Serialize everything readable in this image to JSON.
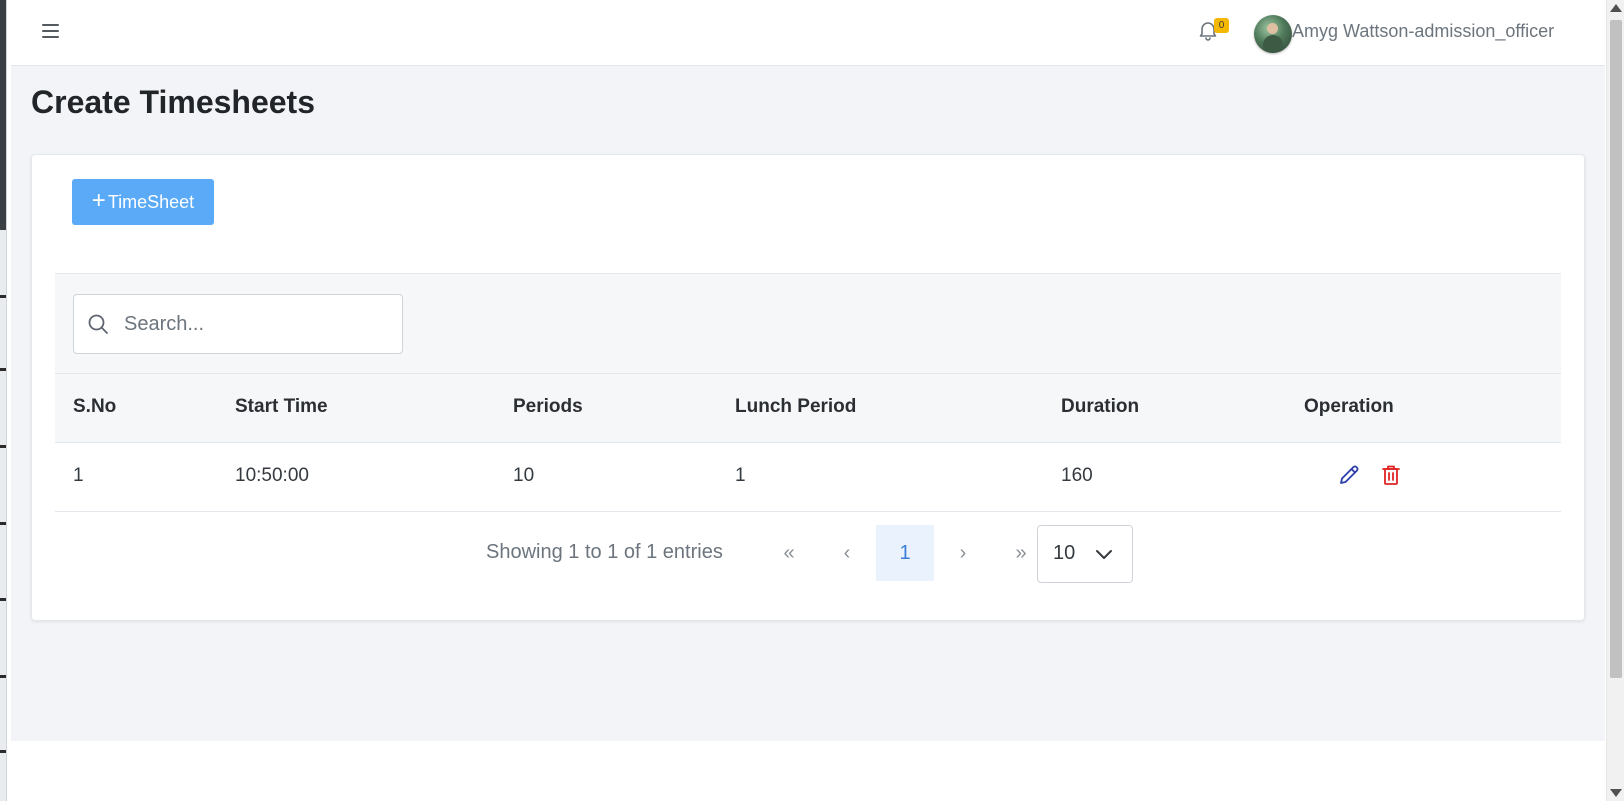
{
  "header": {
    "menu_icon": "hamburger-menu-icon",
    "notification_icon": "bell-icon",
    "notification_count": "0",
    "user_name": "Amyg Wattson-admission_officer"
  },
  "page": {
    "title": "Create Timesheets"
  },
  "toolbar": {
    "add_button_label": "TimeSheet",
    "add_icon": "plus-icon"
  },
  "search": {
    "placeholder": "Search...",
    "value": ""
  },
  "table": {
    "columns": [
      "S.No",
      "Start Time",
      "Periods",
      "Lunch Period",
      "Duration",
      "Operation"
    ],
    "rows": [
      {
        "sno": "1",
        "start_time": "10:50:00",
        "periods": "10",
        "lunch_period": "1",
        "duration": "160",
        "operations": [
          "edit-icon",
          "delete-icon"
        ]
      }
    ]
  },
  "pagination": {
    "info": "Showing 1 to 1 of 1 entries",
    "first": "«",
    "prev": "‹",
    "current_page": "1",
    "next": "›",
    "last": "»",
    "page_size": "10"
  },
  "colors": {
    "primary_button": "#5aaaf8",
    "edit_icon": "#2c3ea8",
    "delete_icon": "#e02424",
    "badge": "#f5b800",
    "active_page_bg": "#e9f2fd"
  }
}
